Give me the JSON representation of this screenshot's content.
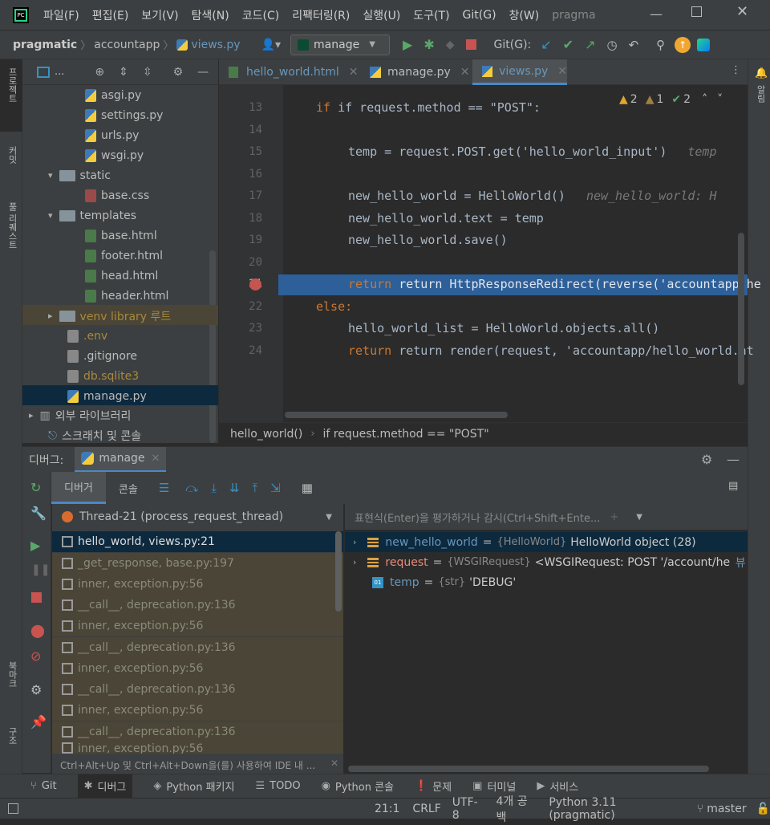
{
  "menu": {
    "items": [
      "파일(F)",
      "편집(E)",
      "보기(V)",
      "탐색(N)",
      "코드(C)",
      "리팩터링(R)",
      "실행(U)",
      "도구(T)",
      "Git(G)",
      "창(W)"
    ],
    "project_title": "pragma"
  },
  "nav": {
    "crumbs": [
      "pragmatic",
      "accountapp",
      "views.py"
    ],
    "run_config": "manage",
    "git_label": "Git(G):"
  },
  "sidebar_left": {
    "project": "프로젝트",
    "commit": "커밋",
    "pull_requests": "풀 리퀘스트",
    "bookmarks": "북마크",
    "structure": "구조"
  },
  "sidebar_right": {
    "notifications": "알림"
  },
  "project": {
    "head": "...",
    "tree": [
      {
        "label": "asgi.py",
        "kind": "py"
      },
      {
        "label": "settings.py",
        "kind": "py"
      },
      {
        "label": "urls.py",
        "kind": "py"
      },
      {
        "label": "wsgi.py",
        "kind": "py"
      },
      {
        "label": "static",
        "kind": "folder"
      },
      {
        "label": "base.css",
        "kind": "css"
      },
      {
        "label": "templates",
        "kind": "folder"
      },
      {
        "label": "base.html",
        "kind": "html"
      },
      {
        "label": "footer.html",
        "kind": "html"
      },
      {
        "label": "head.html",
        "kind": "html"
      },
      {
        "label": "header.html",
        "kind": "html"
      },
      {
        "label": "venv  library 루트",
        "kind": "venv"
      },
      {
        "label": ".env",
        "kind": "file"
      },
      {
        "label": ".gitignore",
        "kind": "file"
      },
      {
        "label": "db.sqlite3",
        "kind": "db"
      },
      {
        "label": "manage.py",
        "kind": "py"
      },
      {
        "label": "외부 라이브러리",
        "kind": "lib"
      },
      {
        "label": "스크래치 및 콘솔",
        "kind": "scratch"
      }
    ]
  },
  "editor": {
    "tabs": [
      "hello_world.html",
      "manage.py",
      "views.py"
    ],
    "warnings": {
      "w1": "2",
      "w2": "1",
      "ok": "2"
    },
    "line_numbers": [
      "13",
      "14",
      "15",
      "16",
      "17",
      "18",
      "19",
      "20",
      "21",
      "22",
      "23",
      "24"
    ],
    "lines": {
      "l13": "if request.method == \"POST\":",
      "l15": "temp = request.POST.get('hello_world_input')",
      "l15_hint": "temp",
      "l17": "new_hello_world = HelloWorld()",
      "l17_hint": "new_hello_world: H",
      "l18": "new_hello_world.text = temp",
      "l19": "new_hello_world.save()",
      "l21": "return HttpResponseRedirect(reverse('accountapp:he",
      "l22": "else:",
      "l23": "hello_world_list = HelloWorld.objects.all()",
      "l24": "return render(request, 'accountapp/hello_world.ht"
    },
    "breadcrumb": [
      "hello_world()",
      "if request.method == \"POST\""
    ]
  },
  "debug": {
    "title": "디버그:",
    "config_tab": "manage",
    "subtabs": [
      "디버거",
      "콘솔"
    ],
    "thread": "Thread-21 (process_request_thread)",
    "eval_placeholder": "표현식(Enter)을 평가하거나 감시(Ctrl+Shift+Ente...",
    "frames": [
      "hello_world, views.py:21",
      "_get_response, base.py:197",
      "inner, exception.py:56",
      "__call__, deprecation.py:136",
      "inner, exception.py:56",
      "__call__, deprecation.py:136",
      "inner, exception.py:56",
      "__call__, deprecation.py:136",
      "inner, exception.py:56",
      "__call__, deprecation.py:136",
      "inner, exception.py:56"
    ],
    "frames_hint": "Ctrl+Alt+Up 및 Ctrl+Alt+Down을(를) 사용하여 IDE 내 ...",
    "variables": [
      {
        "name": "new_hello_world",
        "type": "{HelloWorld}",
        "value": "HelloWorld object (28)",
        "extra": ""
      },
      {
        "name": "request",
        "type": "{WSGIRequest}",
        "value": "<WSGIRequest: POST '/account/he...",
        "extra": "뷰"
      },
      {
        "name": "temp",
        "type": "{str}",
        "value": "'DEBUG'",
        "extra": ""
      }
    ]
  },
  "bottom_tabs": [
    "Git",
    "디버그",
    "Python 패키지",
    "TODO",
    "Python 콘솔",
    "문제",
    "터미널",
    "서비스"
  ],
  "status": {
    "position": "21:1",
    "line_sep": "CRLF",
    "encoding": "UTF-8",
    "indent": "4개 공백",
    "interpreter": "Python 3.11 (pragmatic)",
    "branch": "master"
  }
}
